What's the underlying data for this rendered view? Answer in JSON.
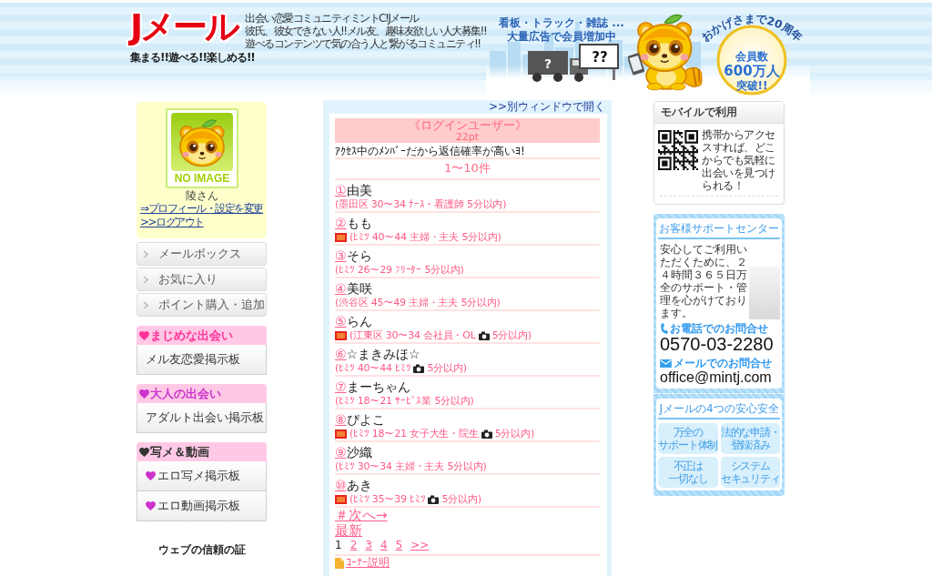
{
  "header": {
    "logo": "Jメール",
    "tagline": "集まる!!遊べる!!楽しめる!!",
    "intro": [
      "出会い恋愛コミュニティミントC!Jメール",
      "彼氏、彼女できない人!!メル友、趣味友欲しい人大募集!!",
      "遊べるコンテンツで気の合う人と繋がるコミュニティ!!"
    ],
    "banner": {
      "headline": [
        "看板・トラック・雑誌 ...",
        "大量広告で会員増加中"
      ],
      "truck_label": "?",
      "sign_label": "??",
      "badge_arc": "おかげさまで20周年",
      "badge_lines": [
        "会員数",
        "600万人",
        "突破!!"
      ]
    }
  },
  "sidebar": {
    "profile": {
      "image_label": "NO IMAGE",
      "name": "陵さん",
      "links": [
        "⇒プロフィール・設定を変更",
        ">>ログアウト"
      ]
    },
    "menu": [
      "メールボックス",
      "お気に入り",
      "ポイント購入・追加"
    ],
    "sections": [
      {
        "title": "まじめな出会い",
        "color": "#ff3399",
        "items": [
          {
            "label": "メル友恋愛掲示板",
            "heart": false
          }
        ]
      },
      {
        "title": "大人の出会い",
        "color": "#cc33cc",
        "items": [
          {
            "label": "アダルト出会い掲示板",
            "heart": false
          }
        ]
      },
      {
        "title": "写メ＆動画",
        "color": "#333333",
        "items": [
          {
            "label": "エロ写メ掲示板",
            "heart": true
          },
          {
            "label": "エロ動画掲示板",
            "heart": true
          }
        ]
      }
    ],
    "trust_title": "ウェブの信頼の証"
  },
  "member_panel": {
    "open_link": ">>別ウィンドウで開く",
    "title": "《ログインユーザー》",
    "points": "22pt",
    "note": "ｱｸｾｽ中のﾒﾝﾊﾞｰだから返信確率が高いﾖ!",
    "range": "1〜10件",
    "members": [
      {
        "number": "①",
        "name": "由美",
        "new": false,
        "profile": "(墨田区 30〜34 ﾅｰｽ・看護師",
        "photo": false,
        "online": "5分以内)"
      },
      {
        "number": "②",
        "name": "もも",
        "new": true,
        "profile": "(ﾋﾐﾂ 40〜44 主婦・主夫",
        "photo": false,
        "online": "5分以内)"
      },
      {
        "number": "③",
        "name": "そら",
        "new": false,
        "profile": "(ﾋﾐﾂ 26〜29 ﾌﾘｰﾀｰ",
        "photo": false,
        "online": "5分以内)"
      },
      {
        "number": "④",
        "name": "美咲",
        "new": false,
        "profile": "(渋谷区 45〜49 主婦・主夫",
        "photo": false,
        "online": "5分以内)"
      },
      {
        "number": "⑤",
        "name": "らん",
        "new": true,
        "profile": "(江東区 30〜34 会社員・OL",
        "photo": true,
        "online": "5分以内)"
      },
      {
        "number": "⑥",
        "name": "☆まきみほ☆",
        "new": false,
        "profile": "(ﾋﾐﾂ 40〜44 ﾋﾐﾂ",
        "photo": true,
        "online": "5分以内)"
      },
      {
        "number": "⑦",
        "name": "まーちゃん",
        "new": false,
        "profile": "(ﾋﾐﾂ 18〜21 ｻｰﾋﾞｽ業",
        "photo": false,
        "online": "5分以内)"
      },
      {
        "number": "⑧",
        "name": "ぴよこ",
        "new": true,
        "profile": "(ﾋﾐﾂ 18〜21 女子大生・院生",
        "photo": true,
        "online": "5分以内)"
      },
      {
        "number": "⑨",
        "name": "沙織",
        "new": false,
        "profile": "(ﾋﾐﾂ 30〜34 主婦・主夫",
        "photo": false,
        "online": "5分以内)"
      },
      {
        "number": "⑩",
        "name": "あき",
        "new": true,
        "profile": "(ﾋﾐﾂ 35〜39 ﾋﾐﾂ",
        "photo": true,
        "online": "5分以内)"
      }
    ],
    "next": "＃次へ→",
    "latest": "最新",
    "pages": [
      {
        "label": "1",
        "selected": true
      },
      {
        "label": "2",
        "selected": false
      },
      {
        "label": "3",
        "selected": false
      },
      {
        "label": "4",
        "selected": false
      },
      {
        "label": "5",
        "selected": false
      },
      {
        "label": ">>",
        "selected": false
      }
    ],
    "corner": "ｺｰﾅｰ説明"
  },
  "right_sidebar": {
    "mobile": {
      "title": "モバイルで利用",
      "text": "携帯からアクセスすれば、どこからでも気軽に出会いを見つけられる！"
    },
    "support": {
      "title": "お客様サポートセンター",
      "text": "安心してご利用いただくために、２４時間３６５日万全のサポート・管理を心がけております。",
      "phone_label": "お電話でのお問合せ",
      "phone": "0570-03-2280",
      "mail_label": "メールでのお問合せ",
      "mail": "office@mintj.com"
    },
    "safety": {
      "title": "Jメールの4つの安心安全",
      "points": [
        {
          "lines": [
            "万全の",
            "サポート体制"
          ]
        },
        {
          "lines": [
            "法的な申請・",
            "登録済み"
          ]
        },
        {
          "lines": [
            "不正は",
            "一切なし"
          ]
        },
        {
          "lines": [
            "システム",
            "セキュリティ"
          ]
        }
      ]
    }
  }
}
